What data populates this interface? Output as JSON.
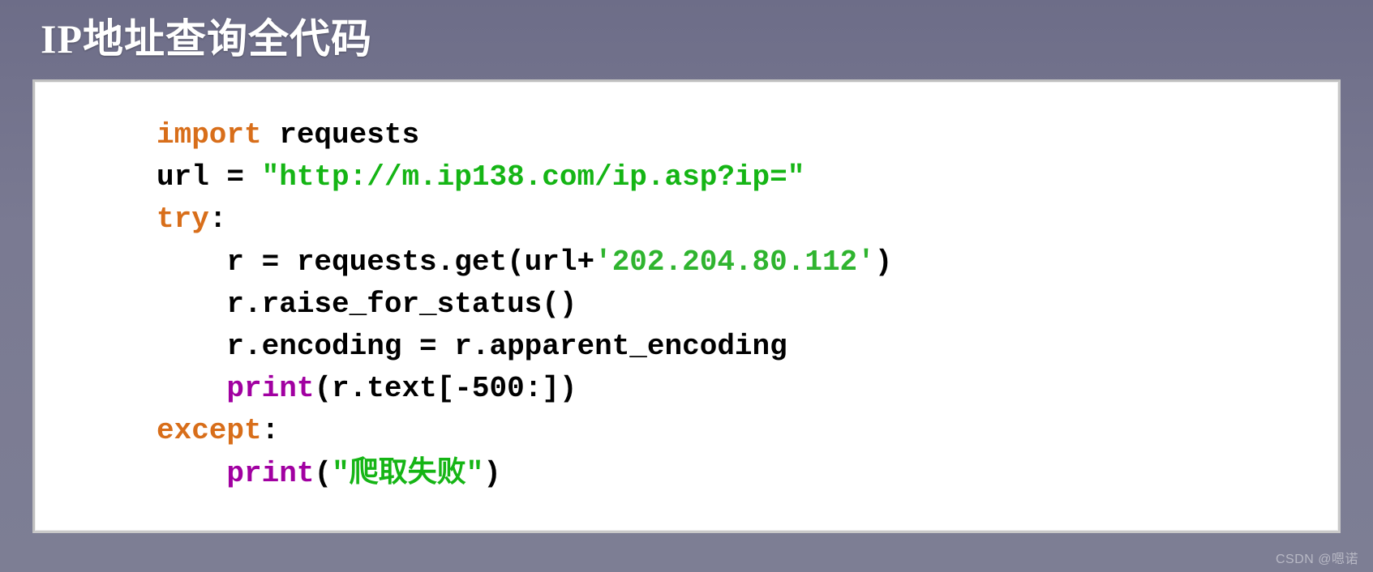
{
  "slide": {
    "title": "IP地址查询全代码"
  },
  "code": {
    "import_kw": "import",
    "import_mod": " requests",
    "assign_lhs": "url = ",
    "url_str": "\"http://m.ip138.com/ip.asp?ip=\"",
    "try_kw": "try",
    "colon": ":",
    "r_get_lhs": "    r = requests.get(url+",
    "ip_str": "'202.204.80.112'",
    "r_get_rhs": ")",
    "raise_line": "    r.raise_for_status()",
    "encoding_line": "    r.encoding = r.apparent_encoding",
    "print_indent": "    ",
    "print_kw": "print",
    "print_arg1": "(r.text[-500:])",
    "except_kw": "except",
    "print_fail_lhs": "(",
    "fail_str": "\"爬取失败\"",
    "print_fail_rhs": ")"
  },
  "watermark": "CSDN @嗯诺"
}
